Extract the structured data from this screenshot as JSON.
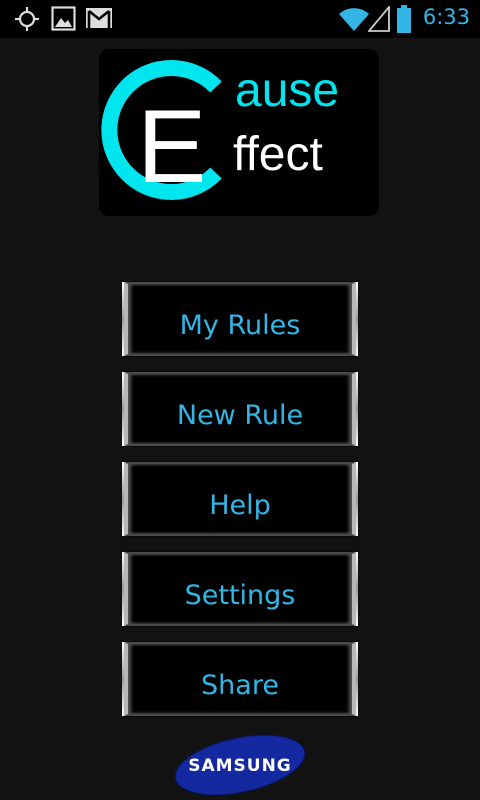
{
  "status_bar": {
    "time": "6:33",
    "icons": [
      "gps-icon",
      "image-icon",
      "gmail-icon",
      "wifi-icon",
      "signal-icon",
      "battery-icon"
    ],
    "accent_color": "#33b5e5"
  },
  "logo": {
    "letter_c": "C",
    "letter_e": "E",
    "word_cause": "ause",
    "word_effect": "ffect",
    "accent_color": "#00e5ee"
  },
  "menu": {
    "text_color": "#33b5e5",
    "items": [
      {
        "label": "My Rules"
      },
      {
        "label": "New Rule"
      },
      {
        "label": "Help"
      },
      {
        "label": "Settings"
      },
      {
        "label": "Share"
      }
    ]
  },
  "footer": {
    "brand": "SAMSUNG",
    "brand_color": "#1428a0"
  }
}
